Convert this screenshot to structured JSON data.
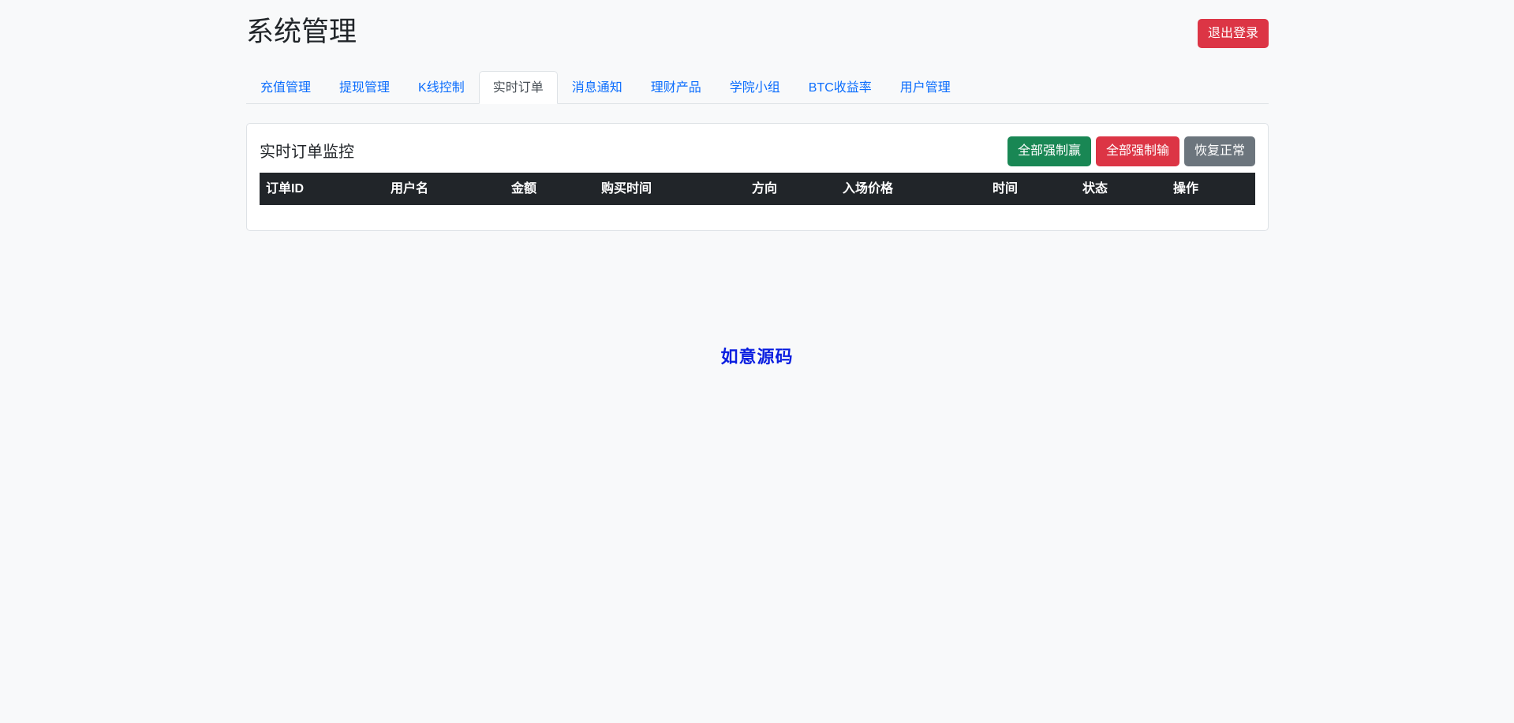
{
  "header": {
    "title": "系统管理",
    "logout_label": "退出登录"
  },
  "tabs": [
    {
      "label": "充值管理",
      "active": false
    },
    {
      "label": "提现管理",
      "active": false
    },
    {
      "label": "K线控制",
      "active": false
    },
    {
      "label": "实时订单",
      "active": true
    },
    {
      "label": "消息通知",
      "active": false
    },
    {
      "label": "理财产品",
      "active": false
    },
    {
      "label": "学院小组",
      "active": false
    },
    {
      "label": "BTC收益率",
      "active": false
    },
    {
      "label": "用户管理",
      "active": false
    }
  ],
  "card": {
    "title": "实时订单监控",
    "buttons": {
      "force_win": "全部强制赢",
      "force_lose": "全部强制输",
      "restore": "恢复正常"
    },
    "table": {
      "columns": [
        "订单ID",
        "用户名",
        "金额",
        "购买时间",
        "方向",
        "入场价格",
        "时间",
        "状态",
        "操作"
      ],
      "rows": []
    }
  },
  "watermark": "如意源码",
  "colors": {
    "primary": "#0d6efd",
    "danger": "#dc3545",
    "success": "#198754",
    "secondary": "#6c757d",
    "table_header": "#212529",
    "watermark": "#0a1ee0"
  }
}
